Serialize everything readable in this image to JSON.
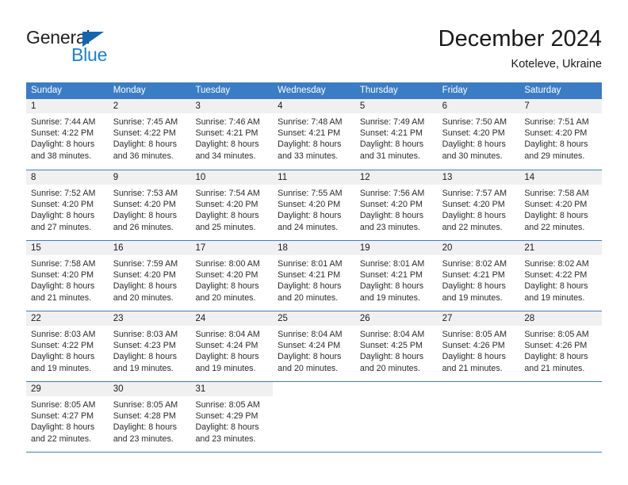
{
  "brand": {
    "name_part1": "General",
    "name_part2": "Blue",
    "triangle_icon": "triangle-logo-icon",
    "color_dark": "#231f20",
    "color_blue": "#1d7fce"
  },
  "header": {
    "month_title": "December 2024",
    "location": "Koteleve, Ukraine"
  },
  "calendar": {
    "accent_color": "#3b7dc4",
    "daynum_bg": "#f0f0f0",
    "weekdays": [
      "Sunday",
      "Monday",
      "Tuesday",
      "Wednesday",
      "Thursday",
      "Friday",
      "Saturday"
    ],
    "weeks": [
      [
        {
          "day": "1",
          "sunrise": "Sunrise: 7:44 AM",
          "sunset": "Sunset: 4:22 PM",
          "daylight_line1": "Daylight: 8 hours",
          "daylight_line2": "and 38 minutes."
        },
        {
          "day": "2",
          "sunrise": "Sunrise: 7:45 AM",
          "sunset": "Sunset: 4:22 PM",
          "daylight_line1": "Daylight: 8 hours",
          "daylight_line2": "and 36 minutes."
        },
        {
          "day": "3",
          "sunrise": "Sunrise: 7:46 AM",
          "sunset": "Sunset: 4:21 PM",
          "daylight_line1": "Daylight: 8 hours",
          "daylight_line2": "and 34 minutes."
        },
        {
          "day": "4",
          "sunrise": "Sunrise: 7:48 AM",
          "sunset": "Sunset: 4:21 PM",
          "daylight_line1": "Daylight: 8 hours",
          "daylight_line2": "and 33 minutes."
        },
        {
          "day": "5",
          "sunrise": "Sunrise: 7:49 AM",
          "sunset": "Sunset: 4:21 PM",
          "daylight_line1": "Daylight: 8 hours",
          "daylight_line2": "and 31 minutes."
        },
        {
          "day": "6",
          "sunrise": "Sunrise: 7:50 AM",
          "sunset": "Sunset: 4:20 PM",
          "daylight_line1": "Daylight: 8 hours",
          "daylight_line2": "and 30 minutes."
        },
        {
          "day": "7",
          "sunrise": "Sunrise: 7:51 AM",
          "sunset": "Sunset: 4:20 PM",
          "daylight_line1": "Daylight: 8 hours",
          "daylight_line2": "and 29 minutes."
        }
      ],
      [
        {
          "day": "8",
          "sunrise": "Sunrise: 7:52 AM",
          "sunset": "Sunset: 4:20 PM",
          "daylight_line1": "Daylight: 8 hours",
          "daylight_line2": "and 27 minutes."
        },
        {
          "day": "9",
          "sunrise": "Sunrise: 7:53 AM",
          "sunset": "Sunset: 4:20 PM",
          "daylight_line1": "Daylight: 8 hours",
          "daylight_line2": "and 26 minutes."
        },
        {
          "day": "10",
          "sunrise": "Sunrise: 7:54 AM",
          "sunset": "Sunset: 4:20 PM",
          "daylight_line1": "Daylight: 8 hours",
          "daylight_line2": "and 25 minutes."
        },
        {
          "day": "11",
          "sunrise": "Sunrise: 7:55 AM",
          "sunset": "Sunset: 4:20 PM",
          "daylight_line1": "Daylight: 8 hours",
          "daylight_line2": "and 24 minutes."
        },
        {
          "day": "12",
          "sunrise": "Sunrise: 7:56 AM",
          "sunset": "Sunset: 4:20 PM",
          "daylight_line1": "Daylight: 8 hours",
          "daylight_line2": "and 23 minutes."
        },
        {
          "day": "13",
          "sunrise": "Sunrise: 7:57 AM",
          "sunset": "Sunset: 4:20 PM",
          "daylight_line1": "Daylight: 8 hours",
          "daylight_line2": "and 22 minutes."
        },
        {
          "day": "14",
          "sunrise": "Sunrise: 7:58 AM",
          "sunset": "Sunset: 4:20 PM",
          "daylight_line1": "Daylight: 8 hours",
          "daylight_line2": "and 22 minutes."
        }
      ],
      [
        {
          "day": "15",
          "sunrise": "Sunrise: 7:58 AM",
          "sunset": "Sunset: 4:20 PM",
          "daylight_line1": "Daylight: 8 hours",
          "daylight_line2": "and 21 minutes."
        },
        {
          "day": "16",
          "sunrise": "Sunrise: 7:59 AM",
          "sunset": "Sunset: 4:20 PM",
          "daylight_line1": "Daylight: 8 hours",
          "daylight_line2": "and 20 minutes."
        },
        {
          "day": "17",
          "sunrise": "Sunrise: 8:00 AM",
          "sunset": "Sunset: 4:20 PM",
          "daylight_line1": "Daylight: 8 hours",
          "daylight_line2": "and 20 minutes."
        },
        {
          "day": "18",
          "sunrise": "Sunrise: 8:01 AM",
          "sunset": "Sunset: 4:21 PM",
          "daylight_line1": "Daylight: 8 hours",
          "daylight_line2": "and 20 minutes."
        },
        {
          "day": "19",
          "sunrise": "Sunrise: 8:01 AM",
          "sunset": "Sunset: 4:21 PM",
          "daylight_line1": "Daylight: 8 hours",
          "daylight_line2": "and 19 minutes."
        },
        {
          "day": "20",
          "sunrise": "Sunrise: 8:02 AM",
          "sunset": "Sunset: 4:21 PM",
          "daylight_line1": "Daylight: 8 hours",
          "daylight_line2": "and 19 minutes."
        },
        {
          "day": "21",
          "sunrise": "Sunrise: 8:02 AM",
          "sunset": "Sunset: 4:22 PM",
          "daylight_line1": "Daylight: 8 hours",
          "daylight_line2": "and 19 minutes."
        }
      ],
      [
        {
          "day": "22",
          "sunrise": "Sunrise: 8:03 AM",
          "sunset": "Sunset: 4:22 PM",
          "daylight_line1": "Daylight: 8 hours",
          "daylight_line2": "and 19 minutes."
        },
        {
          "day": "23",
          "sunrise": "Sunrise: 8:03 AM",
          "sunset": "Sunset: 4:23 PM",
          "daylight_line1": "Daylight: 8 hours",
          "daylight_line2": "and 19 minutes."
        },
        {
          "day": "24",
          "sunrise": "Sunrise: 8:04 AM",
          "sunset": "Sunset: 4:24 PM",
          "daylight_line1": "Daylight: 8 hours",
          "daylight_line2": "and 19 minutes."
        },
        {
          "day": "25",
          "sunrise": "Sunrise: 8:04 AM",
          "sunset": "Sunset: 4:24 PM",
          "daylight_line1": "Daylight: 8 hours",
          "daylight_line2": "and 20 minutes."
        },
        {
          "day": "26",
          "sunrise": "Sunrise: 8:04 AM",
          "sunset": "Sunset: 4:25 PM",
          "daylight_line1": "Daylight: 8 hours",
          "daylight_line2": "and 20 minutes."
        },
        {
          "day": "27",
          "sunrise": "Sunrise: 8:05 AM",
          "sunset": "Sunset: 4:26 PM",
          "daylight_line1": "Daylight: 8 hours",
          "daylight_line2": "and 21 minutes."
        },
        {
          "day": "28",
          "sunrise": "Sunrise: 8:05 AM",
          "sunset": "Sunset: 4:26 PM",
          "daylight_line1": "Daylight: 8 hours",
          "daylight_line2": "and 21 minutes."
        }
      ],
      [
        {
          "day": "29",
          "sunrise": "Sunrise: 8:05 AM",
          "sunset": "Sunset: 4:27 PM",
          "daylight_line1": "Daylight: 8 hours",
          "daylight_line2": "and 22 minutes."
        },
        {
          "day": "30",
          "sunrise": "Sunrise: 8:05 AM",
          "sunset": "Sunset: 4:28 PM",
          "daylight_line1": "Daylight: 8 hours",
          "daylight_line2": "and 23 minutes."
        },
        {
          "day": "31",
          "sunrise": "Sunrise: 8:05 AM",
          "sunset": "Sunset: 4:29 PM",
          "daylight_line1": "Daylight: 8 hours",
          "daylight_line2": "and 23 minutes."
        },
        {
          "day": "",
          "sunrise": "",
          "sunset": "",
          "daylight_line1": "",
          "daylight_line2": ""
        },
        {
          "day": "",
          "sunrise": "",
          "sunset": "",
          "daylight_line1": "",
          "daylight_line2": ""
        },
        {
          "day": "",
          "sunrise": "",
          "sunset": "",
          "daylight_line1": "",
          "daylight_line2": ""
        },
        {
          "day": "",
          "sunrise": "",
          "sunset": "",
          "daylight_line1": "",
          "daylight_line2": ""
        }
      ]
    ]
  }
}
